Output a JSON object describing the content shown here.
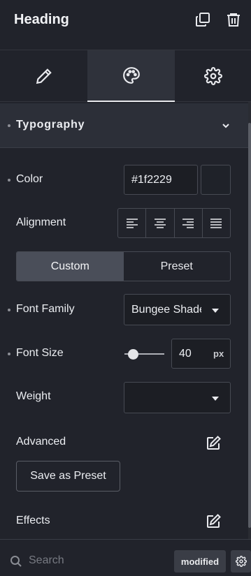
{
  "header": {
    "title": "Heading"
  },
  "tabs": [
    {
      "name": "content",
      "icon": "pencil-icon"
    },
    {
      "name": "style",
      "icon": "palette-icon",
      "active": true
    },
    {
      "name": "advanced",
      "icon": "gear-icon"
    }
  ],
  "section": {
    "label": "Typography"
  },
  "color": {
    "label": "Color",
    "value": "#1f2229"
  },
  "alignment": {
    "label": "Alignment"
  },
  "mode": {
    "custom": "Custom",
    "preset": "Preset",
    "selected": "Custom"
  },
  "font_family": {
    "label": "Font Family",
    "value": "Bungee Shade"
  },
  "font_size": {
    "label": "Font Size",
    "value": "40",
    "unit": "px"
  },
  "weight": {
    "label": "Weight",
    "value": ""
  },
  "advanced": {
    "label": "Advanced"
  },
  "save_preset": {
    "label": "Save as Preset"
  },
  "effects": {
    "label": "Effects"
  },
  "footer": {
    "search_placeholder": "Search",
    "badge": "modified"
  },
  "colors": {
    "background": "#21232b",
    "active_tab": "#2f323b",
    "section_bg": "#2c2f38"
  }
}
